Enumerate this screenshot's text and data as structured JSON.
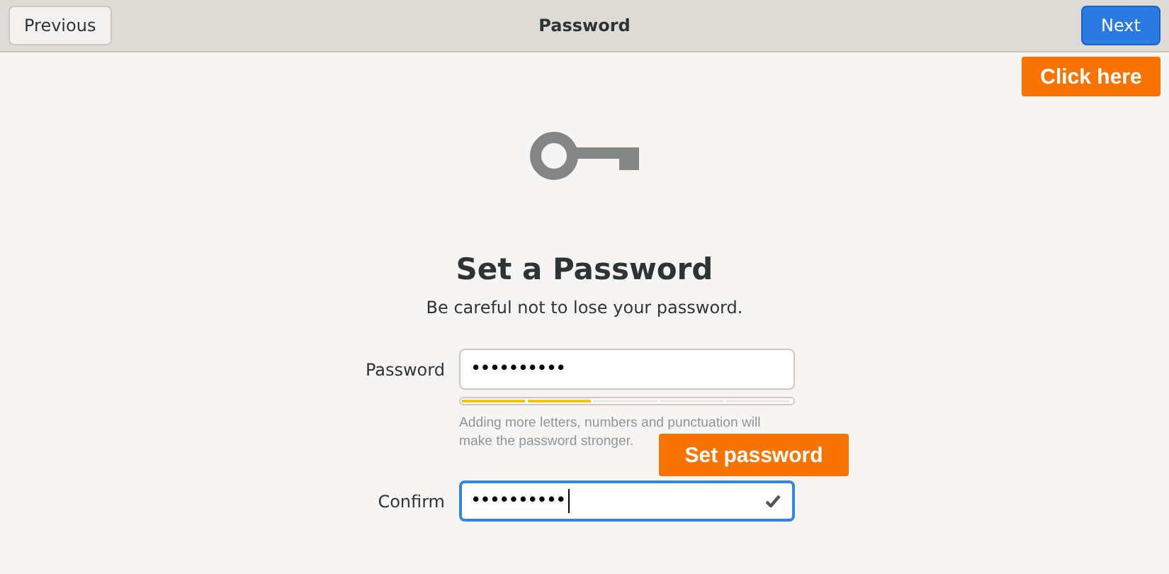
{
  "header": {
    "title": "Password",
    "buttons": [
      {
        "label": "Previous",
        "kind": "plain"
      },
      {
        "label": "Next",
        "kind": "suggested"
      }
    ]
  },
  "heading": "Set a Password",
  "subtitle": "Be careful not to lose your password.",
  "fields": [
    {
      "label": "Password",
      "value": "••••••••••",
      "focused": false,
      "matched": false
    },
    {
      "label": "Confirm",
      "value": "••••••••••",
      "focused": true,
      "matched": true
    }
  ],
  "strength": {
    "level": 0.4,
    "hint": "Adding more letters, numbers and punctuation will make the password stronger."
  },
  "callouts": [
    {
      "text": "Click here"
    },
    {
      "text": "Set password"
    }
  ]
}
